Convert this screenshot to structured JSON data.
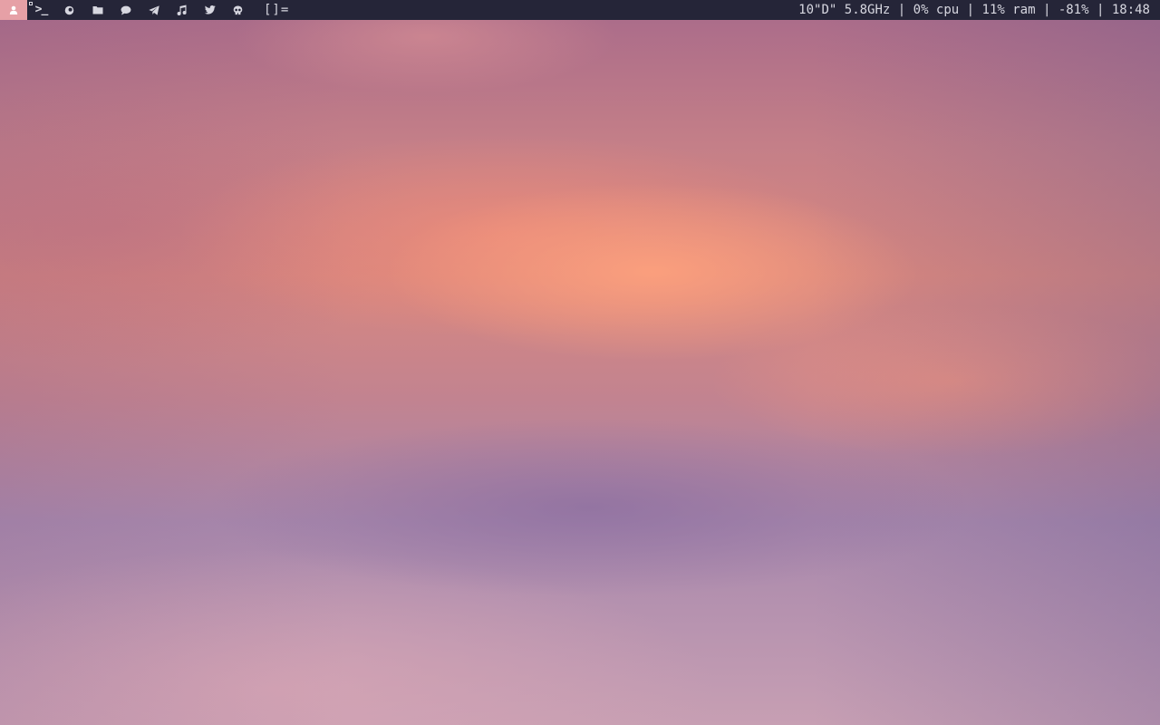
{
  "desktop": {
    "wallpaper": "sunset-clouds"
  },
  "bar": {
    "background": "#252538",
    "foreground": "#d7d7e0",
    "accent": "#e6a0a6",
    "tags": [
      {
        "icon": "user-icon",
        "active": true
      },
      {
        "icon": "terminal-icon",
        "glyph": ">_",
        "occupied": true
      },
      {
        "icon": "browser-icon"
      },
      {
        "icon": "folder-icon"
      },
      {
        "icon": "chat-icon"
      },
      {
        "icon": "telegram-icon"
      },
      {
        "icon": "music-icon"
      },
      {
        "icon": "twitter-icon"
      },
      {
        "icon": "skull-icon"
      }
    ],
    "layout_symbol": "[]=",
    "status": {
      "weather": "10\"D\"",
      "cpu_freq": "5.8GHz",
      "cpu": "0% cpu",
      "ram": "11% ram",
      "volume": "-81%",
      "time": "18:48",
      "separator": " | "
    }
  }
}
